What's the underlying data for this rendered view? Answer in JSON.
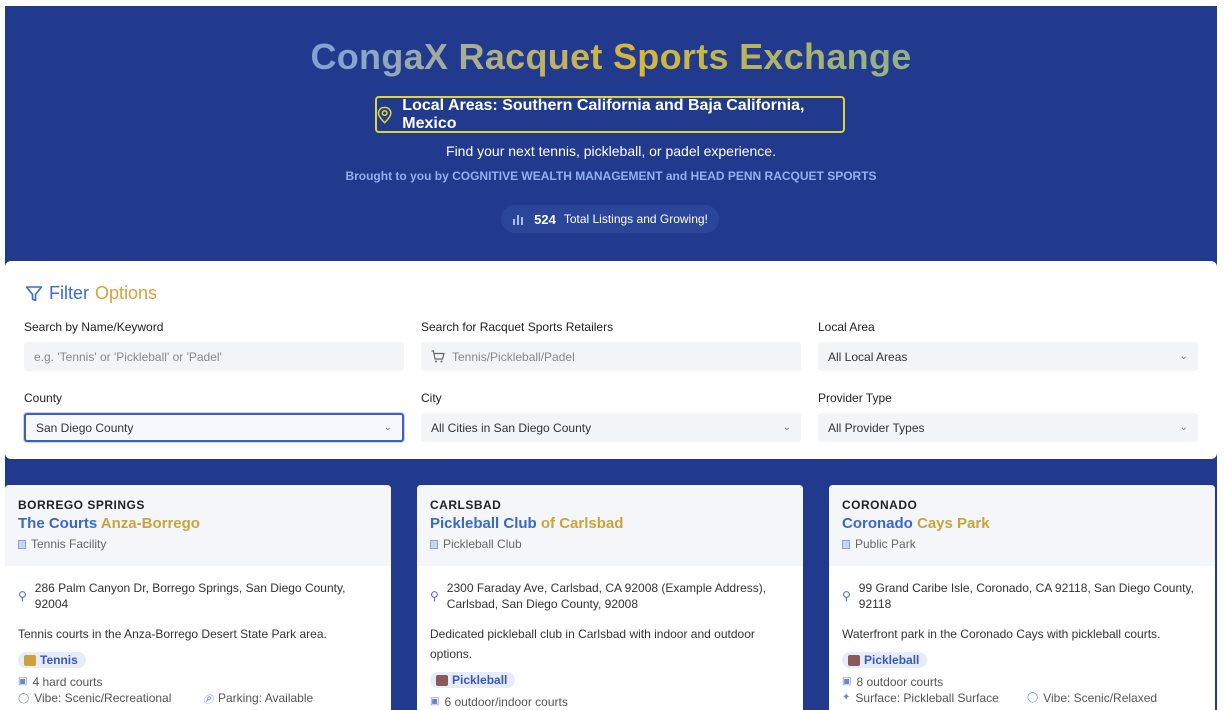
{
  "header": {
    "title": "CongaX Racquet Sports Exchange",
    "area_badge": "Local Areas: Southern California and Baja California, Mexico",
    "tagline": "Find your next tennis, pickleball, or padel experience.",
    "brought_by": "Brought to you by COGNITIVE WEALTH MANAGEMENT and HEAD PENN RACQUET SPORTS",
    "listing_count": "524",
    "listing_text": "Total Listings and Growing!"
  },
  "filters": {
    "title_part1": "Filter",
    "title_part2": "Options",
    "keyword": {
      "label": "Search by Name/Keyword",
      "placeholder": "e.g. 'Tennis' or 'Pickleball' or 'Padel'"
    },
    "retailers": {
      "label": "Search for Racquet Sports Retailers",
      "placeholder": "Tennis/Pickleball/Padel"
    },
    "local_area": {
      "label": "Local Area",
      "value": "All Local Areas"
    },
    "county": {
      "label": "County",
      "value": "San Diego County"
    },
    "city": {
      "label": "City",
      "value": "All Cities in San Diego County"
    },
    "provider_type": {
      "label": "Provider Type",
      "value": "All Provider Types"
    }
  },
  "cards": [
    {
      "city": "BORREGO SPRINGS",
      "name1": "The Courts ",
      "name2": "Anza-Borrego",
      "type": "Tennis Facility",
      "address": "286 Palm Canyon Dr, Borrego Springs, San Diego County, 92004",
      "description": "Tennis courts in the Anza-Borrego Desert State Park area.",
      "sport": "Tennis",
      "courts": "4 hard courts",
      "vibe": "Vibe: Scenic/Recreational",
      "extra": "Parking: Available"
    },
    {
      "city": "CARLSBAD",
      "name1": "Pickleball Club ",
      "name2": "of Carlsbad",
      "type": "Pickleball Club",
      "address": "2300 Faraday Ave, Carlsbad, CA 92008 (Example Address), Carlsbad, San Diego County, 92008",
      "description": "Dedicated pickleball club in Carlsbad with indoor and outdoor options.",
      "sport": "Pickleball",
      "courts": "6 outdoor/indoor courts"
    },
    {
      "city": "CORONADO",
      "name1": "Coronado ",
      "name2": "Cays Park",
      "type": "Public Park",
      "address": "99 Grand Caribe Isle, Coronado, CA 92118, San Diego County, 92118",
      "description": "Waterfront park in the Coronado Cays with pickleball courts.",
      "sport": "Pickleball",
      "courts": "8 outdoor courts",
      "surface": "Surface: Pickleball Surface",
      "vibe": "Vibe: Scenic/Relaxed"
    }
  ],
  "colors": {
    "page_bg": "#223a8e",
    "accent_blue": "#3a68c9",
    "accent_gold": "#c9a43d",
    "badge_border": "#d9d53b"
  }
}
